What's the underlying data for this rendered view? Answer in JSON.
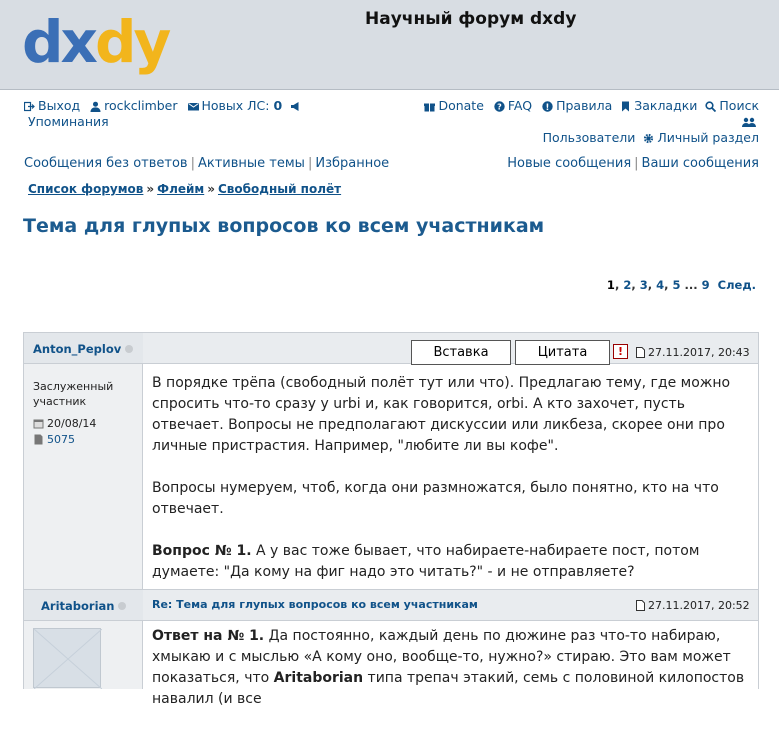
{
  "logo": {
    "part1": "dx",
    "part2": "dy"
  },
  "site_title": "Научный форум dxdy",
  "nav_left": {
    "logout": "Выход",
    "user": "rockclimber",
    "pm_label": "Новых ЛС:",
    "pm_count": "0",
    "mentions": "Упоминания"
  },
  "nav_right": {
    "donate": "Donate",
    "faq": "FAQ",
    "rules": "Правила",
    "bookmarks": "Закладки",
    "search": "Поиск",
    "users": "Пользователи",
    "ucp": "Личный раздел"
  },
  "subnav_left": [
    "Сообщения без ответов",
    "Активные темы",
    "Избранное"
  ],
  "subnav_right": [
    "Новые сообщения",
    "Ваши сообщения"
  ],
  "breadcrumbs": [
    "Список форумов",
    "Флейм",
    "Свободный полёт"
  ],
  "breadcrumb_sep": "»",
  "topic_title": "Тема для глупых вопросов ко всем участникам",
  "pagination": {
    "current": "1",
    "pages": [
      "2",
      "3",
      "4",
      "5"
    ],
    "ellipsis": "...",
    "last": "9",
    "next": "След."
  },
  "post1": {
    "author": "Anton_Peplov",
    "rank_line1": "Заслуженный",
    "rank_line2": "участник",
    "joined": "20/08/14",
    "posts": "5075",
    "insert_button": "Вставка",
    "quote_button": "Цитата",
    "report": "!",
    "date": "27.11.2017, 20:43",
    "para1": "В порядке трёпа (свободный полёт тут или что). Предлагаю тему, где можно спросить что-то сразу у urbi и, как говорится, orbi. А кто захочет, пусть отвечает. Вопросы не предполагают дискуссии или ликбеза, скорее они про личные пристрастия. Например, \"любите ли вы кофе\".",
    "para2": "Вопросы нумеруем, чтоб, когда они размножатся, было понятно, кто на что отвечает.",
    "q_label": "Вопрос № 1.",
    "q_text": " А у вас тоже бывает, что набираете-набираете пост, потом думаете: \"Да кому на фиг надо это читать?\" - и не отправляете?"
  },
  "post2": {
    "author": "Aritaborian",
    "title": "Re: Тема для глупых вопросов ко всем участникам",
    "date": "27.11.2017, 20:52",
    "a_label": "Ответ на № 1.",
    "a_text1": " Да постоянно, каждый день по дюжине раз что-то набираю, хмыкаю и с мыслью «А кому оно, вообще-то, нужно?» стираю. Это вам может показаться, что ",
    "a_bold": "Aritaborian",
    "a_text2": " типа трепач этакий, семь с половиной килопостов навалил (и все"
  },
  "colors": {
    "link": "#105289",
    "title": "#1c5b8f",
    "header_bg": "#d8dde3",
    "logo_blue": "#3b6fb6",
    "logo_yellow": "#f2b51c"
  }
}
